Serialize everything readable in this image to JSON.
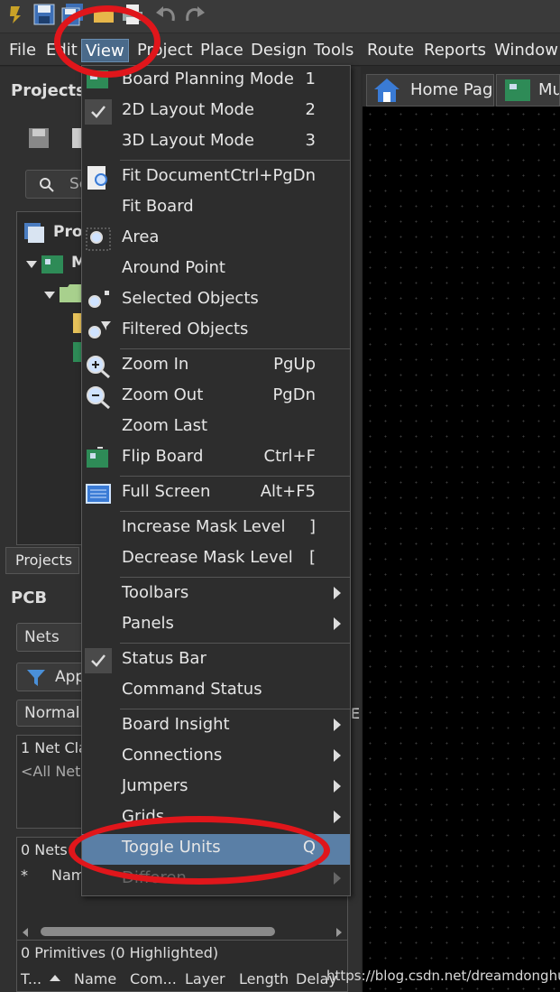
{
  "menubar": [
    "File",
    "Edit",
    "View",
    "Project",
    "Place",
    "Design",
    "Tools",
    "Route",
    "Reports",
    "Window"
  ],
  "doc_tabs": [
    "Home Page",
    "Mu"
  ],
  "projects_panel": {
    "title": "Projects",
    "search_placeholder": "Se",
    "tree_item_project": "Proj",
    "tree_item_pcb": "M",
    "bottom_tab": "Projects"
  },
  "pcb_panel": {
    "title": "PCB",
    "nets_select": "Nets",
    "apply_button": "App",
    "normal_select": "Normal",
    "net_class_header": "1 Net Cla",
    "all_nets": "<All Nets",
    "nets_count": "0 Nets (",
    "col_star": "*",
    "col_name": "Nam",
    "primitives": "0 Primitives (0 Highlighted)",
    "prim_columns": [
      "T...",
      "Name",
      "Com...",
      "Layer",
      "Length",
      "Delay"
    ],
    "edge_letter": "E"
  },
  "view_menu": [
    {
      "label": "Board Planning Mode",
      "shortcut": "1",
      "icon": "board-planning-icon"
    },
    {
      "label": "2D Layout Mode",
      "shortcut": "2",
      "checked": true
    },
    {
      "label": "3D Layout Mode",
      "shortcut": "3"
    },
    {
      "label": "Fit Document",
      "shortcut": "Ctrl+PgDn",
      "icon": "fit-document-icon"
    },
    {
      "label": "Fit Board"
    },
    {
      "label": "Area",
      "icon": "zoom-area-icon"
    },
    {
      "label": "Around Point"
    },
    {
      "label": "Selected Objects",
      "icon": "zoom-selected-icon"
    },
    {
      "label": "Filtered Objects",
      "icon": "zoom-filter-icon"
    },
    {
      "label": "Zoom In",
      "shortcut": "PgUp",
      "icon": "zoom-in-icon"
    },
    {
      "label": "Zoom Out",
      "shortcut": "PgDn",
      "icon": "zoom-out-icon"
    },
    {
      "label": "Zoom Last"
    },
    {
      "label": "Flip Board",
      "shortcut": "Ctrl+F",
      "icon": "flip-board-icon"
    },
    {
      "label": "Full Screen",
      "shortcut": "Alt+F5",
      "icon": "full-screen-icon"
    },
    {
      "label": "Increase Mask Level",
      "shortcut": "]"
    },
    {
      "label": "Decrease Mask Level",
      "shortcut": "["
    },
    {
      "label": "Toolbars",
      "submenu": true
    },
    {
      "label": "Panels",
      "submenu": true
    },
    {
      "label": "Status Bar",
      "checked": true
    },
    {
      "label": "Command Status"
    },
    {
      "label": "Board Insight",
      "submenu": true
    },
    {
      "label": "Connections",
      "submenu": true
    },
    {
      "label": "Jumpers",
      "submenu": true
    },
    {
      "label": "Grids",
      "submenu": true
    },
    {
      "label": "Toggle Units",
      "shortcut": "Q",
      "highlighted": true
    },
    {
      "label": "Differen",
      "submenu": true,
      "disabled": true
    }
  ],
  "watermark": "https://blog.csdn.net/dreamdonghui",
  "colors": {
    "highlight": "#5a7fa6",
    "annotation": "#e0161b"
  }
}
